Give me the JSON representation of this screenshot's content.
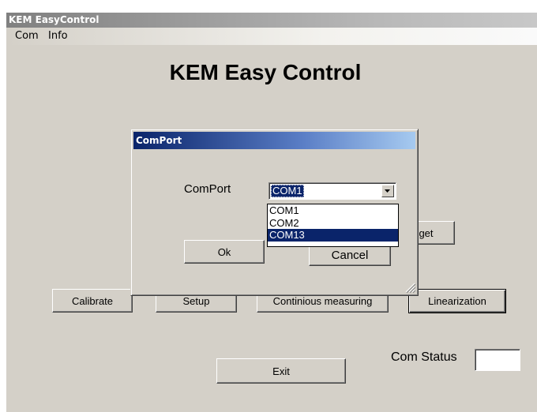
{
  "window": {
    "title": "KEM EasyControl"
  },
  "menu": [
    "Com",
    "Info"
  ],
  "app_title": "KEM Easy Control",
  "buttons": {
    "target_partial": "get",
    "calibrate": "Calibrate",
    "setup": "Setup",
    "continuous": "Continious measuring",
    "linearization": "Linearization",
    "exit": "Exit"
  },
  "status": {
    "label": "Com Status",
    "value": ""
  },
  "dialog": {
    "title": "ComPort",
    "label": "ComPort",
    "selected": "COM1",
    "options": [
      "COM1",
      "COM2",
      "COM13"
    ],
    "highlighted_option": "COM13",
    "ok": "Ok",
    "cancel": "Cancel"
  }
}
